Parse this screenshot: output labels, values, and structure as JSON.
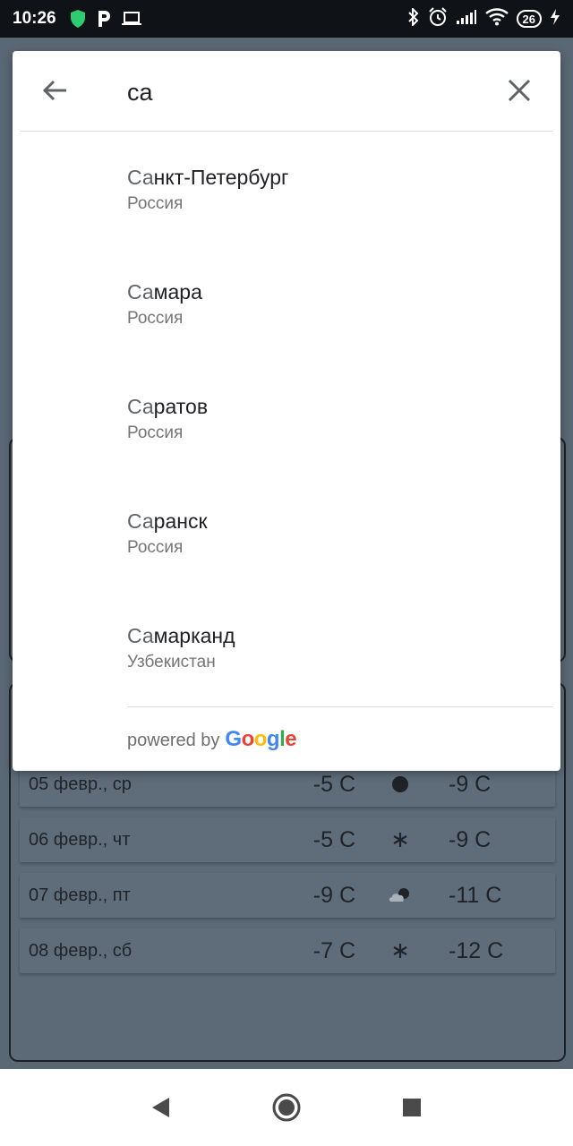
{
  "status_bar": {
    "time": "10:26",
    "battery": "26",
    "icons": [
      "shield-icon",
      "parking-icon",
      "laptop-icon",
      "bluetooth-icon",
      "alarm-icon",
      "signal-icon",
      "wifi-icon",
      "battery-icon",
      "charging-icon"
    ]
  },
  "search": {
    "query": "са",
    "back_icon": "arrow-left-icon",
    "clear_icon": "close-icon"
  },
  "results": [
    {
      "match": "Са",
      "rest": "нкт-Петербург",
      "country": "Россия"
    },
    {
      "match": "Са",
      "rest": "мара",
      "country": "Россия"
    },
    {
      "match": "Са",
      "rest": "ратов",
      "country": "Россия"
    },
    {
      "match": "Са",
      "rest": "ранск",
      "country": "Россия"
    },
    {
      "match": "Са",
      "rest": "марканд",
      "country": "Узбекистан"
    }
  ],
  "attribution": {
    "powered_by": "powered by",
    "brand": "Google",
    "brand_colors": [
      "#4285F4",
      "#EA4335",
      "#FBBC05",
      "#4285F4",
      "#34A853",
      "#EA4335"
    ]
  },
  "forecast": [
    {
      "date": "05 февр., ср",
      "max": "-5 C",
      "icon": "clear-night-icon",
      "min": "-9 C"
    },
    {
      "date": "06 февр., чт",
      "max": "-5 C",
      "icon": "snowflake-icon",
      "min": "-9 C"
    },
    {
      "date": "07 февр., пт",
      "max": "-9 C",
      "icon": "cloudy-night-icon",
      "min": "-11 C"
    },
    {
      "date": "08 февр., сб",
      "max": "-7 C",
      "icon": "snowflake-icon",
      "min": "-12 C"
    }
  ],
  "navbar": {
    "icons": [
      "back-triangle-icon",
      "home-circle-icon",
      "recents-square-icon"
    ]
  }
}
